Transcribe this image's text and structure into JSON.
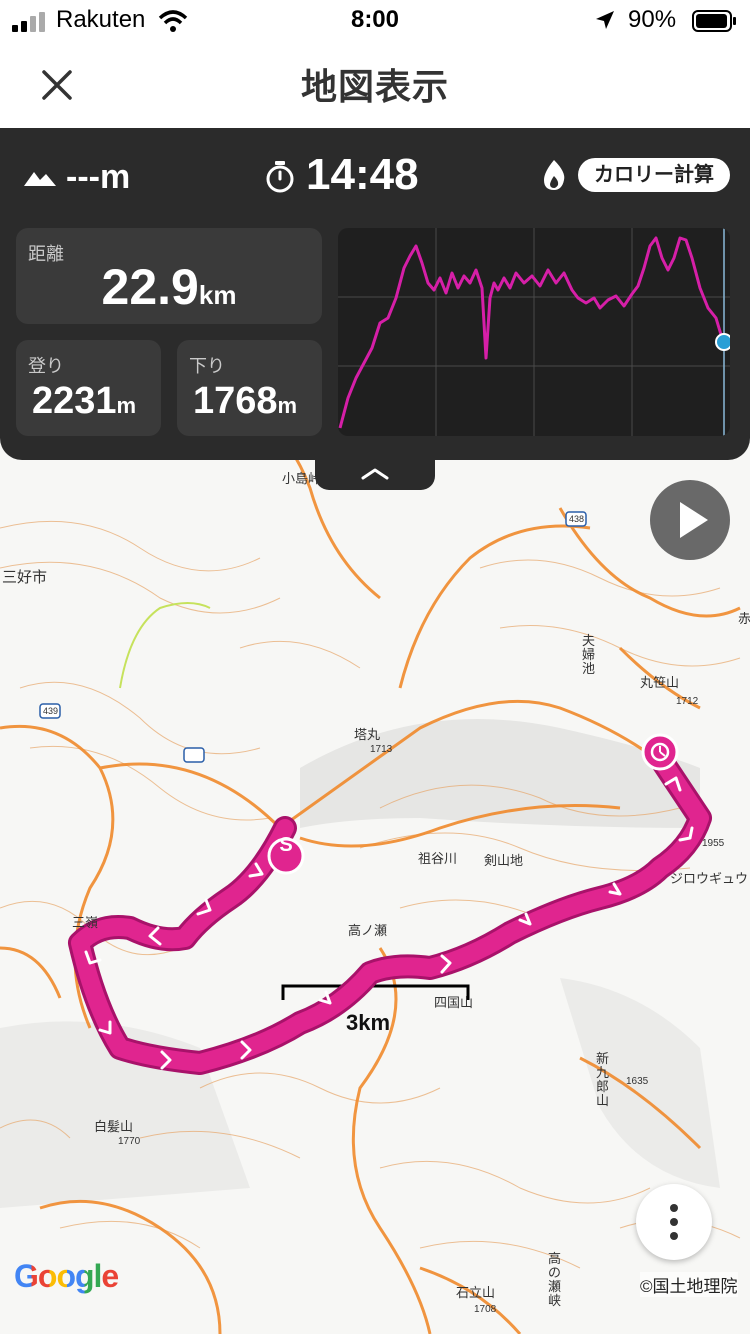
{
  "status_bar": {
    "carrier": "Rakuten",
    "time": "8:00",
    "battery": "90%"
  },
  "nav": {
    "title": "地図表示"
  },
  "panel": {
    "altitude": "---m",
    "elapsed_time": "14:48",
    "calorie_button": "カロリー計算",
    "distance": {
      "label": "距離",
      "value": "22.9",
      "unit": "km"
    },
    "ascent": {
      "label": "登り",
      "value": "2231",
      "unit": "m"
    },
    "descent": {
      "label": "下り",
      "value": "1768",
      "unit": "m"
    }
  },
  "map": {
    "scale": "3km",
    "attribution": "©国土地理院",
    "google": "Google",
    "start_marker": "S",
    "place_labels": [
      "三好市",
      "小島峠",
      "塔丸",
      "1713",
      "祖谷川",
      "剣山地",
      "高ノ瀬",
      "四国山",
      "三嶺",
      "白髪山",
      "1770",
      "新九郎山",
      "1635",
      "夫婦池",
      "丸笹山",
      "1712",
      "ジロウギュウ",
      "1955",
      "石立山",
      "1708",
      "高の瀬峡",
      "438",
      "439",
      "赤"
    ]
  },
  "colors": {
    "track": "#e0258f",
    "panel_bg": "#2b2b2b",
    "graph_line": "#d61fa8",
    "marker_blue": "#2a9fd6"
  }
}
